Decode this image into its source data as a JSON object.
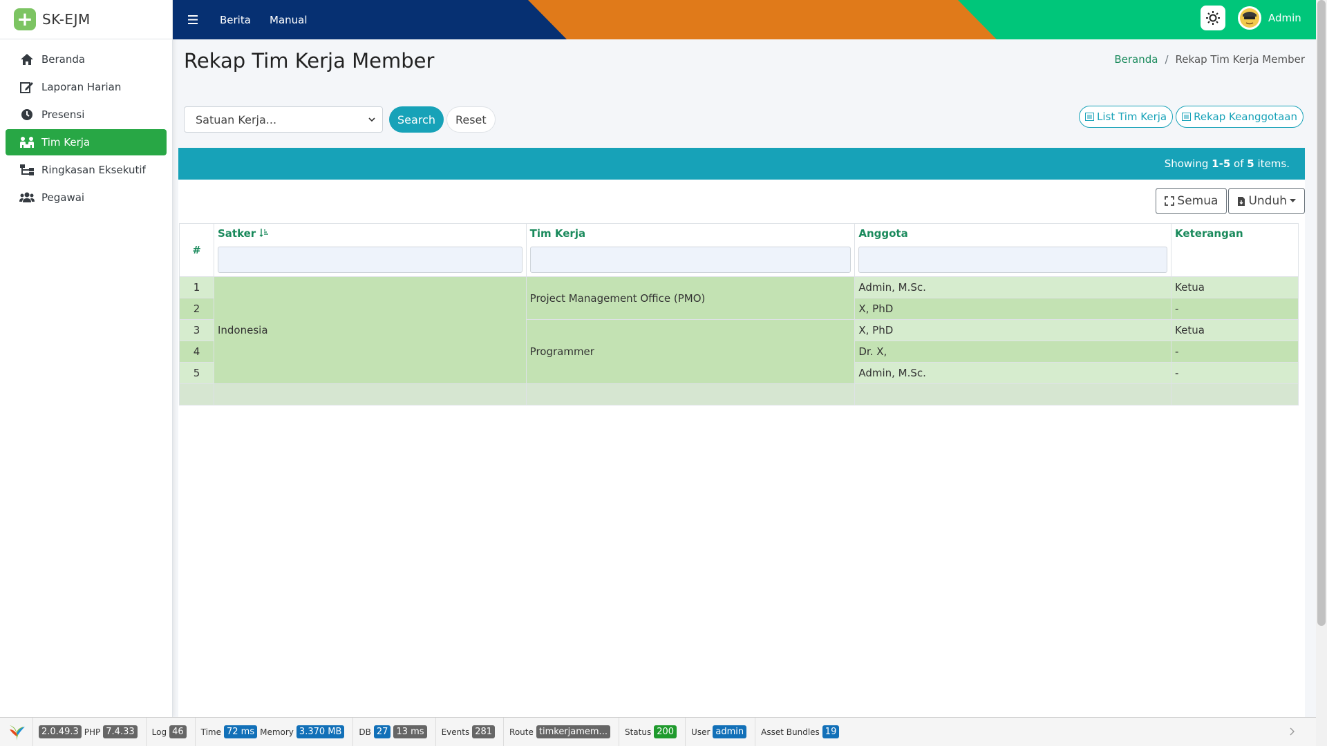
{
  "brand": {
    "name": "SK-EJM"
  },
  "sidebar": {
    "items": [
      {
        "label": "Beranda",
        "icon": "home-icon",
        "active": false
      },
      {
        "label": "Laporan Harian",
        "icon": "edit-icon",
        "active": false
      },
      {
        "label": "Presensi",
        "icon": "clock-icon",
        "active": false
      },
      {
        "label": "Tim Kerja",
        "icon": "team-icon",
        "active": true
      },
      {
        "label": "Ringkasan Eksekutif",
        "icon": "sitemap-icon",
        "active": false
      },
      {
        "label": "Pegawai",
        "icon": "users-icon",
        "active": false
      }
    ]
  },
  "navbar": {
    "links": [
      "Berita",
      "Manual"
    ],
    "user": "Admin",
    "colors": {
      "blue": "#063072",
      "orange": "#e07a1a",
      "green": "#00c67a"
    }
  },
  "page": {
    "title": "Rekap Tim Kerja Member",
    "breadcrumb": {
      "home": "Beranda",
      "current": "Rekap Tim Kerja Member"
    }
  },
  "filter": {
    "select_placeholder": "Satuan Kerja...",
    "search_label": "Search",
    "reset_label": "Reset"
  },
  "actions": {
    "list_tim": "List Tim Kerja",
    "rekap": "Rekap Keanggotaan"
  },
  "grid": {
    "summary": {
      "prefix": "Showing ",
      "range": "1-5",
      "mid": " of ",
      "total": "5",
      "suffix": " items."
    },
    "toolbar": {
      "all": "Semua",
      "download": "Unduh"
    },
    "headers": {
      "num": "#",
      "satker": "Satker",
      "tim": "Tim Kerja",
      "anggota": "Anggota",
      "keterangan": "Keterangan"
    },
    "satker": "Indonesia",
    "groups": [
      "Project Management Office (PMO)",
      "Programmer"
    ],
    "rows": [
      {
        "num": "1",
        "anggota": "Admin, M.Sc.",
        "keterangan": "Ketua"
      },
      {
        "num": "2",
        "anggota": "X, PhD",
        "keterangan": "-"
      },
      {
        "num": "3",
        "anggota": "X, PhD",
        "keterangan": "Ketua"
      },
      {
        "num": "4",
        "anggota": "Dr. X,",
        "keterangan": "-"
      },
      {
        "num": "5",
        "anggota": "Admin, M.Sc.",
        "keterangan": "-"
      }
    ]
  },
  "debug": {
    "yii_version": "2.0.49.3",
    "php_label": "PHP",
    "php_version": "7.4.33",
    "log_label": "Log",
    "log_count": "46",
    "time_label": "Time",
    "time_value": "72 ms",
    "memory_label": "Memory",
    "memory_value": "3.370 MB",
    "db_label": "DB",
    "db_count": "27",
    "db_time": "13 ms",
    "events_label": "Events",
    "events_count": "281",
    "route_label": "Route",
    "route_value": "timkerjamem...",
    "status_label": "Status",
    "status_value": "200",
    "user_label": "User",
    "user_value": "admin",
    "assets_label": "Asset Bundles",
    "assets_count": "19"
  }
}
